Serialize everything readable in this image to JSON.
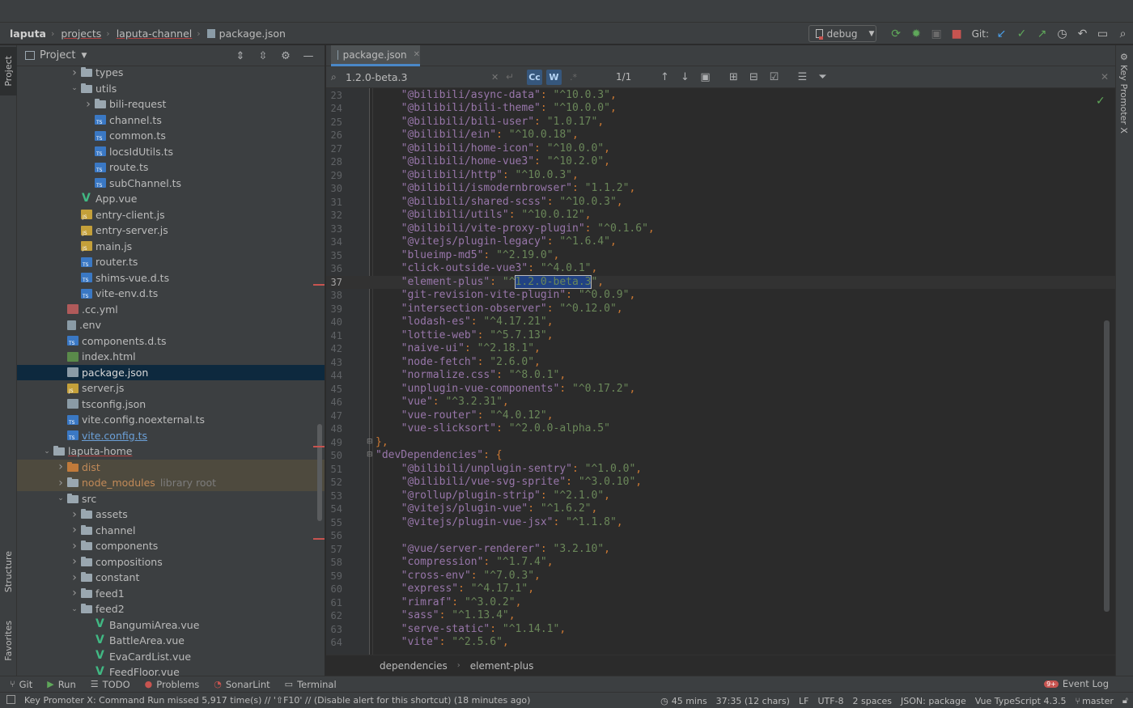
{
  "nav": {
    "breadcrumbs": [
      "laputa",
      "projects",
      "laputa-channel",
      "package.json"
    ],
    "run_config": "debug",
    "git_label": "Git:"
  },
  "left_stripe": {
    "project": "Project",
    "structure": "Structure",
    "favorites": "Favorites"
  },
  "right_stripe": {
    "key_promoter": "Key Promoter X"
  },
  "project_panel": {
    "title": "Project",
    "tree": [
      {
        "label": "types",
        "type": "folder",
        "depth": 3,
        "arrow": "right"
      },
      {
        "label": "utils",
        "type": "folder",
        "depth": 3,
        "arrow": "down"
      },
      {
        "label": "bili-request",
        "type": "folder",
        "depth": 4,
        "arrow": "right"
      },
      {
        "label": "channel.ts",
        "type": "ts",
        "depth": 4
      },
      {
        "label": "common.ts",
        "type": "ts",
        "depth": 4
      },
      {
        "label": "locsIdUtils.ts",
        "type": "ts",
        "depth": 4
      },
      {
        "label": "route.ts",
        "type": "ts",
        "depth": 4
      },
      {
        "label": "subChannel.ts",
        "type": "ts",
        "depth": 4
      },
      {
        "label": "App.vue",
        "type": "vue",
        "depth": 3
      },
      {
        "label": "entry-client.js",
        "type": "js",
        "depth": 3
      },
      {
        "label": "entry-server.js",
        "type": "js",
        "depth": 3
      },
      {
        "label": "main.js",
        "type": "js",
        "depth": 3
      },
      {
        "label": "router.ts",
        "type": "ts",
        "depth": 3
      },
      {
        "label": "shims-vue.d.ts",
        "type": "ts",
        "depth": 3
      },
      {
        "label": "vite-env.d.ts",
        "type": "ts",
        "depth": 3
      },
      {
        "label": ".cc.yml",
        "type": "yml",
        "depth": 2
      },
      {
        "label": ".env",
        "type": "file",
        "depth": 2
      },
      {
        "label": "components.d.ts",
        "type": "ts",
        "depth": 2
      },
      {
        "label": "index.html",
        "type": "html",
        "depth": 2
      },
      {
        "label": "package.json",
        "type": "json",
        "depth": 2,
        "selected": true
      },
      {
        "label": "server.js",
        "type": "js",
        "depth": 2
      },
      {
        "label": "tsconfig.json",
        "type": "json",
        "depth": 2
      },
      {
        "label": "vite.config.noexternal.ts",
        "type": "ts",
        "depth": 2
      },
      {
        "label": "vite.config.ts",
        "type": "ts",
        "depth": 2,
        "style": "blue"
      },
      {
        "label": "laputa-home",
        "type": "folder",
        "depth": 1,
        "arrow": "down",
        "style": "under"
      },
      {
        "label": "dist",
        "type": "folder-orange",
        "depth": 2,
        "arrow": "right",
        "style": "orange",
        "excluded": true
      },
      {
        "label": "node_modules",
        "type": "folder",
        "depth": 2,
        "arrow": "right",
        "style": "orange",
        "excluded": true,
        "suffix": "library root"
      },
      {
        "label": "src",
        "type": "folder",
        "depth": 2,
        "arrow": "down"
      },
      {
        "label": "assets",
        "type": "folder",
        "depth": 3,
        "arrow": "right"
      },
      {
        "label": "channel",
        "type": "folder",
        "depth": 3,
        "arrow": "right"
      },
      {
        "label": "components",
        "type": "folder",
        "depth": 3,
        "arrow": "right"
      },
      {
        "label": "compositions",
        "type": "folder",
        "depth": 3,
        "arrow": "right"
      },
      {
        "label": "constant",
        "type": "folder",
        "depth": 3,
        "arrow": "right"
      },
      {
        "label": "feed1",
        "type": "folder",
        "depth": 3,
        "arrow": "right"
      },
      {
        "label": "feed2",
        "type": "folder",
        "depth": 3,
        "arrow": "down"
      },
      {
        "label": "BangumiArea.vue",
        "type": "vue",
        "depth": 4
      },
      {
        "label": "BattleArea.vue",
        "type": "vue",
        "depth": 4
      },
      {
        "label": "EvaCardList.vue",
        "type": "vue",
        "depth": 4
      },
      {
        "label": "FeedFloor.vue",
        "type": "vue",
        "depth": 4
      }
    ]
  },
  "editor": {
    "tab": "package.json",
    "search": {
      "query": "1.2.0-beta.3",
      "case_option": "Cc",
      "word_option": "W",
      "regex_option": ".*",
      "matches": "1/1"
    },
    "current_line": 37,
    "lines": [
      {
        "n": 23,
        "key": "@bilibili/async-data",
        "val": "^10.0.3"
      },
      {
        "n": 24,
        "key": "@bilibili/bili-theme",
        "val": "^10.0.0"
      },
      {
        "n": 25,
        "key": "@bilibili/bili-user",
        "val": "1.0.17"
      },
      {
        "n": 26,
        "key": "@bilibili/ein",
        "val": "^10.0.18"
      },
      {
        "n": 27,
        "key": "@bilibili/home-icon",
        "val": "^10.0.0"
      },
      {
        "n": 28,
        "key": "@bilibili/home-vue3",
        "val": "^10.2.0"
      },
      {
        "n": 29,
        "key": "@bilibili/http",
        "val": "^10.0.3"
      },
      {
        "n": 30,
        "key": "@bilibili/ismodernbrowser",
        "val": "1.1.2"
      },
      {
        "n": 31,
        "key": "@bilibili/shared-scss",
        "val": "^10.0.3"
      },
      {
        "n": 32,
        "key": "@bilibili/utils",
        "val": "^10.0.12"
      },
      {
        "n": 33,
        "key": "@bilibili/vite-proxy-plugin",
        "val": "^0.1.6"
      },
      {
        "n": 34,
        "key": "@vitejs/plugin-legacy",
        "val": "^1.6.4"
      },
      {
        "n": 35,
        "key": "blueimp-md5",
        "val": "^2.19.0"
      },
      {
        "n": 36,
        "key": "click-outside-vue3",
        "val": "^4.0.1"
      },
      {
        "n": 37,
        "key": "element-plus",
        "val": "^1.2.0-beta.3",
        "highlight": "1.2.0-beta.3"
      },
      {
        "n": 38,
        "key": "git-revision-vite-plugin",
        "val": "^0.0.9"
      },
      {
        "n": 39,
        "key": "intersection-observer",
        "val": "^0.12.0"
      },
      {
        "n": 40,
        "key": "lodash-es",
        "val": "^4.17.21"
      },
      {
        "n": 41,
        "key": "lottie-web",
        "val": "^5.7.13"
      },
      {
        "n": 42,
        "key": "naive-ui",
        "val": "^2.18.1"
      },
      {
        "n": 43,
        "key": "node-fetch",
        "val": "2.6.0"
      },
      {
        "n": 44,
        "key": "normalize.css",
        "val": "^8.0.1"
      },
      {
        "n": 45,
        "key": "unplugin-vue-components",
        "val": "^0.17.2"
      },
      {
        "n": 46,
        "key": "vue",
        "val": "^3.2.31"
      },
      {
        "n": 47,
        "key": "vue-router",
        "val": "^4.0.12"
      },
      {
        "n": 48,
        "key": "vue-slicksort",
        "val": "^2.0.0-alpha.5",
        "last": true
      },
      {
        "n": 49,
        "raw": "},",
        "indent": 1
      },
      {
        "n": 50,
        "raw_key": "devDependencies",
        "indent": 1
      },
      {
        "n": 51,
        "key": "@bilibili/unplugin-sentry",
        "val": "^1.0.0"
      },
      {
        "n": 52,
        "key": "@bilibili/vue-svg-sprite",
        "val": "^3.0.10"
      },
      {
        "n": 53,
        "key": "@rollup/plugin-strip",
        "val": "^2.1.0"
      },
      {
        "n": 54,
        "key": "@vitejs/plugin-vue",
        "val": "^1.6.2"
      },
      {
        "n": 55,
        "key": "@vitejs/plugin-vue-jsx",
        "val": "^1.1.8"
      },
      {
        "n": 56,
        "raw": ""
      },
      {
        "n": 57,
        "key": "@vue/server-renderer",
        "val": "3.2.10"
      },
      {
        "n": 58,
        "key": "compression",
        "val": "^1.7.4"
      },
      {
        "n": 59,
        "key": "cross-env",
        "val": "^7.0.3"
      },
      {
        "n": 60,
        "key": "express",
        "val": "^4.17.1"
      },
      {
        "n": 61,
        "key": "rimraf",
        "val": "^3.0.2"
      },
      {
        "n": 62,
        "key": "sass",
        "val": "^1.13.4"
      },
      {
        "n": 63,
        "key": "serve-static",
        "val": "^1.14.1"
      },
      {
        "n": 64,
        "key": "vite",
        "val": "^2.5.6"
      }
    ],
    "breadcrumb": [
      "dependencies",
      "element-plus"
    ]
  },
  "tool_windows": [
    "Git",
    "Run",
    "TODO",
    "Problems",
    "SonarLint",
    "Terminal"
  ],
  "event_log": {
    "badge": "9+",
    "label": "Event Log"
  },
  "status": {
    "message": "Key Promoter X: Command Run missed 5,917 time(s) // '⇧F10' // (Disable alert for this shortcut) (18 minutes ago)",
    "time": "45 mins",
    "position": "37:35 (12 chars)",
    "line_sep": "LF",
    "encoding": "UTF-8",
    "indent": "2 spaces",
    "schema": "JSON: package",
    "language": "Vue TypeScript 4.3.5",
    "branch": "master"
  }
}
